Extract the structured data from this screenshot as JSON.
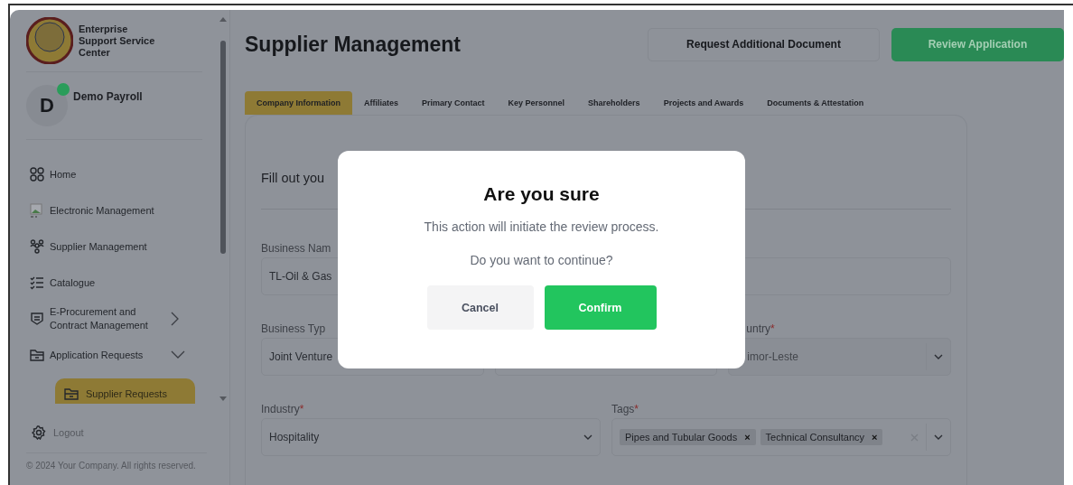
{
  "sidebar": {
    "org_name": "Enterprise Support Service Center",
    "user": {
      "initial": "D",
      "name": "Demo Payroll",
      "online": true
    },
    "items": [
      {
        "label": "Home",
        "selected": false
      },
      {
        "label": "Electronic Management",
        "selected": false
      },
      {
        "label": "Supplier Management",
        "selected": false
      },
      {
        "label": "Catalogue",
        "selected": false
      },
      {
        "label": "E-Procurement and Contract Management",
        "selected": false,
        "expanded": false
      },
      {
        "label": "Application Requests",
        "selected": false,
        "expanded": true,
        "children": [
          {
            "label": "Supplier Requests",
            "selected": true
          }
        ]
      }
    ],
    "logout": "Logout",
    "footer": "© 2024 Your Company. All rights reserved."
  },
  "header": {
    "title": "Supplier Management",
    "buttons": [
      {
        "label": "Request Additional Document",
        "kind": "outline"
      },
      {
        "label": "Review Application",
        "kind": "primary"
      }
    ]
  },
  "tabs": [
    {
      "label": "Company Information",
      "selected": true
    },
    {
      "label": "Affiliates",
      "selected": false
    },
    {
      "label": "Primary Contact",
      "selected": false
    },
    {
      "label": "Key Personnel",
      "selected": false
    },
    {
      "label": "Shareholders",
      "selected": false
    },
    {
      "label": "Projects and Awards",
      "selected": false
    },
    {
      "label": "Documents & Attestation",
      "selected": false
    }
  ],
  "form": {
    "heading": "Fill out you",
    "business_name": {
      "label": "Business Nam",
      "value": "TL-Oil & Gas"
    },
    "business_type": {
      "label": "Business Typ",
      "value": "Joint Venture"
    },
    "country": {
      "label": "untry",
      "required_mark": "*",
      "value": "imor-Leste"
    },
    "industry": {
      "label": "Industry",
      "required_mark": "*",
      "value": "Hospitality"
    },
    "tags": {
      "label": "Tags",
      "required_mark": "*",
      "values": [
        {
          "label": "Pipes and Tubular Goods",
          "remove": "×"
        },
        {
          "label": "Technical Consultancy",
          "remove": "×"
        }
      ]
    }
  },
  "dialog": {
    "title": "Are you sure",
    "message": "This action will initiate the review process.",
    "question": "Do you want to continue?",
    "buttons": [
      {
        "label": "Cancel",
        "kind": "secondary"
      },
      {
        "label": "Confirm",
        "kind": "primary"
      }
    ]
  }
}
